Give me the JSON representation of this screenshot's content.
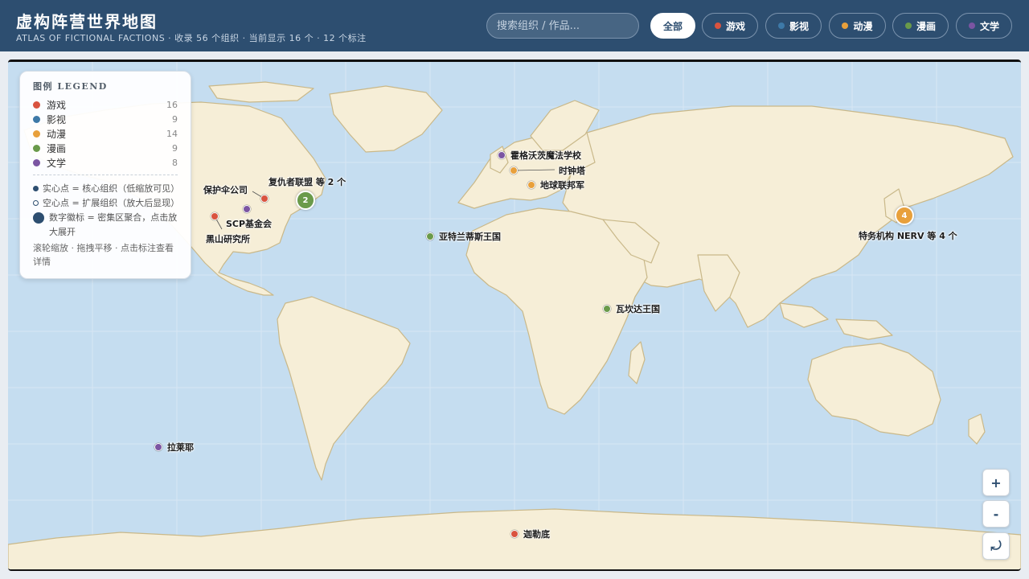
{
  "header": {
    "title": "虚构阵营世界地图",
    "subtitle": "ATLAS OF FICTIONAL FACTIONS · 收录 56 个组织 · 当前显示 16 个 · 12 个标注",
    "search_placeholder": "搜索组织 / 作品..."
  },
  "filters": [
    {
      "label": "全部",
      "color": ""
    },
    {
      "label": "游戏",
      "color": "#d9533f"
    },
    {
      "label": "影视",
      "color": "#3d79a8"
    },
    {
      "label": "动漫",
      "color": "#e8a03b"
    },
    {
      "label": "漫画",
      "color": "#6a9a4a"
    },
    {
      "label": "文学",
      "color": "#7b55a2"
    }
  ],
  "legend": {
    "title": "图例 LEGEND",
    "items": [
      {
        "name": "游戏",
        "count": "16",
        "color": "#d9533f"
      },
      {
        "name": "影视",
        "count": "9",
        "color": "#3d79a8"
      },
      {
        "name": "动漫",
        "count": "14",
        "color": "#e8a03b"
      },
      {
        "name": "漫画",
        "count": "9",
        "color": "#6a9a4a"
      },
      {
        "name": "文学",
        "count": "8",
        "color": "#7b55a2"
      }
    ],
    "note_solid": "实心点 = 核心组织（低缩放可见）",
    "note_hollow": "空心点 = 扩展组织（放大后显现）",
    "note_cluster": "数字徽标 = 密集区聚合，点击放大展开",
    "hint": "滚轮缩放 · 拖拽平移 · 点击标注查看详情"
  },
  "markers": [
    {
      "label": "霍格沃茨魔法学校",
      "color": "#7b55a2"
    },
    {
      "label": "时钟塔",
      "color": "#e8a03b"
    },
    {
      "label": "地球联邦军",
      "color": "#e8a03b"
    },
    {
      "label": "保护伞公司",
      "color": "#d9533f"
    },
    {
      "label": "SCP基金会",
      "color": "#7b55a2"
    },
    {
      "label": "黑山研究所",
      "color": "#d9533f"
    },
    {
      "label": "亚特兰蒂斯王国",
      "color": "#6a9a4a"
    },
    {
      "label": "瓦坎达王国",
      "color": "#6a9a4a"
    },
    {
      "label": "拉莱耶",
      "color": "#7b55a2"
    },
    {
      "label": "迦勒底",
      "color": "#d9533f"
    }
  ],
  "clusters": [
    {
      "count": "2",
      "label": "复仇者联盟 等 2 个",
      "color": "#6a9a4a"
    },
    {
      "count": "4",
      "label": "特务机构 NERV 等 4 个",
      "color": "#e8a03b"
    }
  ],
  "zoom": {
    "in": "+",
    "out": "-",
    "reset": "⤾"
  }
}
